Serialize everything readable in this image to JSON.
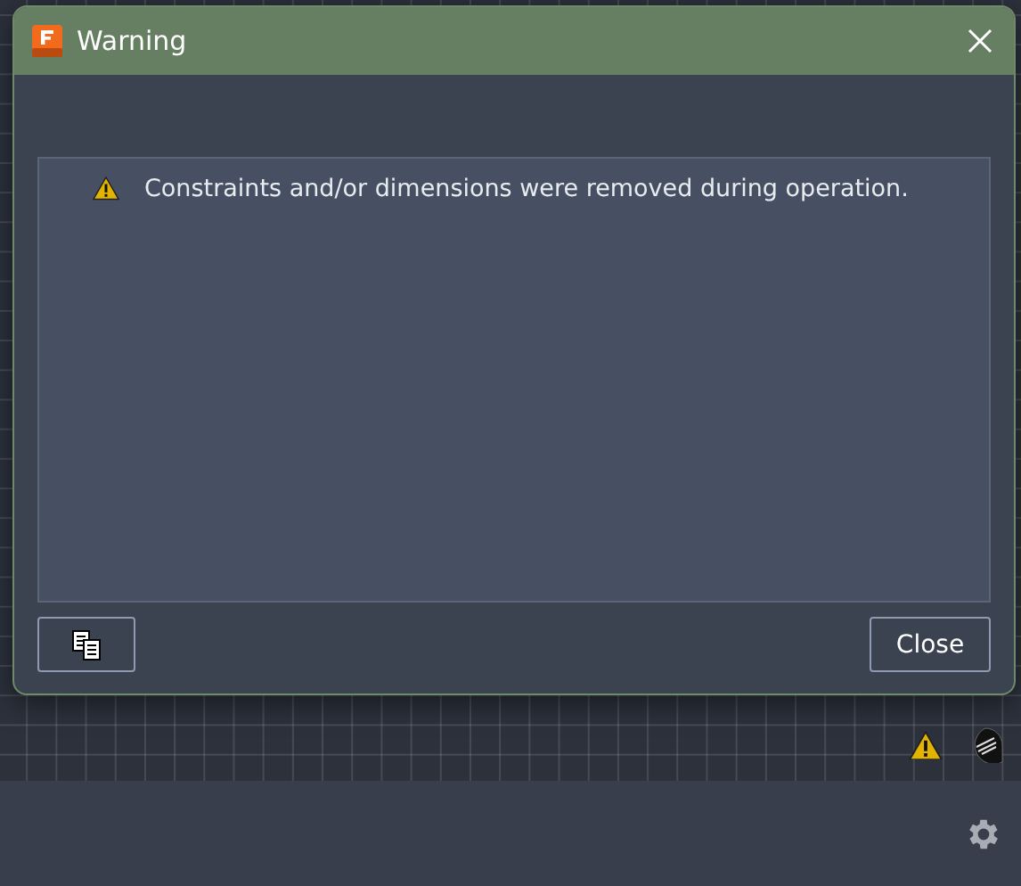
{
  "window": {
    "title": "Warning"
  },
  "messages": [
    {
      "kind": "warning",
      "text": "Constraints and/or dimensions were removed during operation."
    }
  ],
  "buttons": [
    {
      "kind": "copy"
    },
    {
      "kind": "text",
      "label": "Close"
    }
  ]
}
